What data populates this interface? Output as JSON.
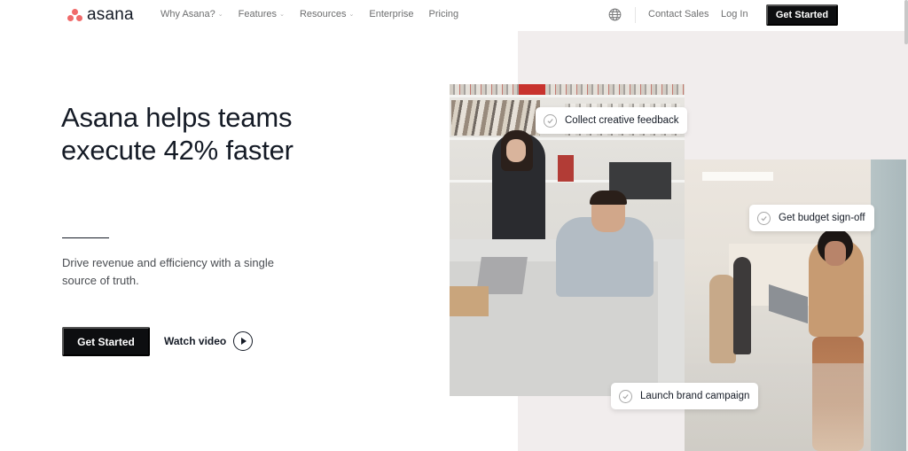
{
  "nav": {
    "brand": "asana",
    "brand_color": "#f06a6a",
    "links": [
      {
        "label": "Why Asana?",
        "has_dropdown": true
      },
      {
        "label": "Features",
        "has_dropdown": true
      },
      {
        "label": "Resources",
        "has_dropdown": true
      },
      {
        "label": "Enterprise",
        "has_dropdown": false
      },
      {
        "label": "Pricing",
        "has_dropdown": false
      }
    ],
    "language_icon": "globe-icon",
    "contact_sales": "Contact Sales",
    "log_in": "Log In",
    "cta": "Get Started"
  },
  "hero": {
    "title_line1": "Asana helps teams",
    "title_line2": "execute 42% faster",
    "subtitle": "Drive revenue and efficiency with a single source of truth.",
    "cta": "Get Started",
    "watch_video": "Watch video",
    "play_icon": "play-circle-icon"
  },
  "task_cards": [
    {
      "label": "Collect creative feedback",
      "icon": "check-circle-icon"
    },
    {
      "label": "Get budget sign-off",
      "icon": "check-circle-icon"
    },
    {
      "label": "Launch brand campaign",
      "icon": "check-circle-icon"
    }
  ],
  "colors": {
    "cta_bg": "#0d0e10",
    "panel_bg": "#f1eded",
    "text": "#151b26"
  }
}
